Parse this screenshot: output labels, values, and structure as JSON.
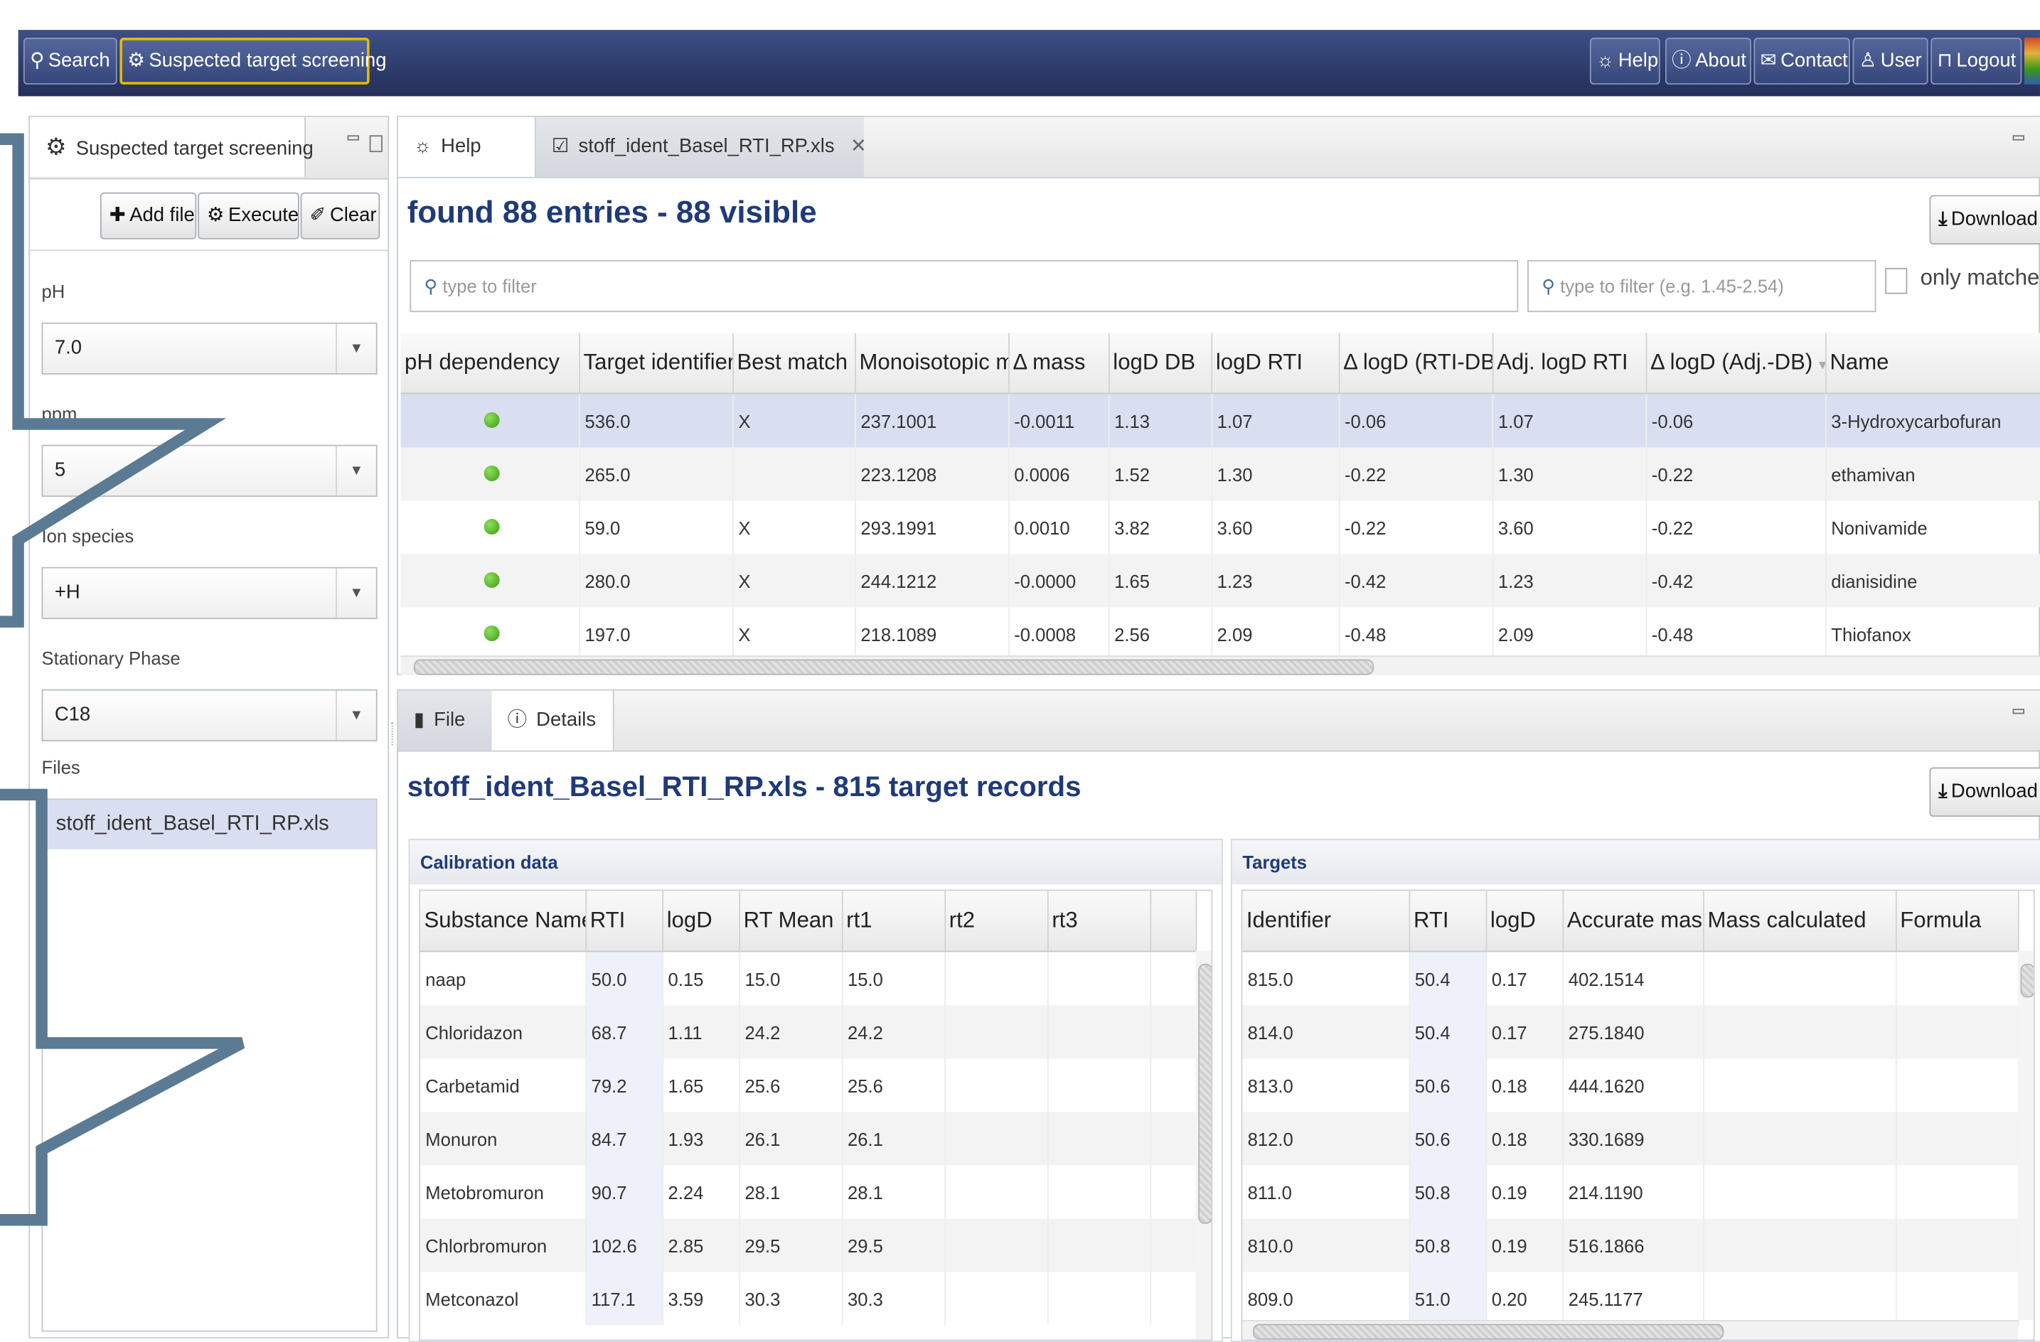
{
  "topbar": {
    "left_buttons": [
      {
        "label": "Search",
        "icon": "search-icon"
      },
      {
        "label": "Suspected target screening",
        "icon": "gear-icon"
      }
    ],
    "right_buttons": [
      {
        "label": "Help",
        "icon": "lightbulb-icon"
      },
      {
        "label": "About",
        "icon": "info-icon"
      },
      {
        "label": "Contact",
        "icon": "mail-icon"
      },
      {
        "label": "User",
        "icon": "user-icon"
      },
      {
        "label": "Logout",
        "icon": "unlock-icon"
      }
    ]
  },
  "left_panel": {
    "tab_label": "Suspected target screening",
    "buttons": {
      "add_file": "Add file",
      "execute": "Execute",
      "clear": "Clear"
    },
    "ph": {
      "label": "pH",
      "value": "7.0"
    },
    "ppm": {
      "label": "ppm",
      "value": "5"
    },
    "ion_species": {
      "label": "Ion species",
      "value": "+H"
    },
    "stationary_phase": {
      "label": "Stationary Phase",
      "value": "C18"
    },
    "files": {
      "label": "Files",
      "items": [
        "stoff_ident_Basel_RTI_RP.xls"
      ]
    }
  },
  "results_panel": {
    "tabs": [
      "Help",
      "stoff_ident_Basel_RTI_RP.xls"
    ],
    "heading": "found 88 entries - 88 visible",
    "download_label": "Download",
    "filter_placeholder": "type to filter",
    "filter2_placeholder": "type to filter (e.g. 1.45-2.54)",
    "only_matches_label": "only matches",
    "columns": [
      "pH dependency",
      "Target identifier",
      "Best match",
      "Monoisotopic ma",
      "Δ mass",
      "logD DB",
      "logD RTI",
      "Δ logD (RTI-DB)",
      "Adj. logD RTI",
      "Δ logD (Adj.-DB)",
      "Name"
    ],
    "rows": [
      [
        "",
        "536.0",
        "X",
        "237.1001",
        "-0.0011",
        "1.13",
        "1.07",
        "-0.06",
        "1.07",
        "-0.06",
        "3-Hydroxycarbofuran"
      ],
      [
        "",
        "265.0",
        "",
        "223.1208",
        "0.0006",
        "1.52",
        "1.30",
        "-0.22",
        "1.30",
        "-0.22",
        "ethamivan"
      ],
      [
        "",
        "59.0",
        "X",
        "293.1991",
        "0.0010",
        "3.82",
        "3.60",
        "-0.22",
        "3.60",
        "-0.22",
        "Nonivamide"
      ],
      [
        "",
        "280.0",
        "X",
        "244.1212",
        "-0.0000",
        "1.65",
        "1.23",
        "-0.42",
        "1.23",
        "-0.42",
        "dianisidine"
      ],
      [
        "",
        "197.0",
        "X",
        "218.1089",
        "-0.0008",
        "2.56",
        "2.09",
        "-0.48",
        "2.09",
        "-0.48",
        "Thiofanox"
      ]
    ]
  },
  "detail_panel": {
    "tabs": [
      "File",
      "Details"
    ],
    "heading": "stoff_ident_Basel_RTI_RP.xls - 815 target records",
    "download_label": "Download",
    "calibration": {
      "title": "Calibration data",
      "columns": [
        "Substance Name",
        "RTI",
        "logD",
        "RT Mean",
        "rt1",
        "rt2",
        "rt3"
      ],
      "rows": [
        [
          "naap",
          "50.0",
          "0.15",
          "15.0",
          "15.0",
          "",
          ""
        ],
        [
          "Chloridazon",
          "68.7",
          "1.11",
          "24.2",
          "24.2",
          "",
          ""
        ],
        [
          "Carbetamid",
          "79.2",
          "1.65",
          "25.6",
          "25.6",
          "",
          ""
        ],
        [
          "Monuron",
          "84.7",
          "1.93",
          "26.1",
          "26.1",
          "",
          ""
        ],
        [
          "Metobromuron",
          "90.7",
          "2.24",
          "28.1",
          "28.1",
          "",
          ""
        ],
        [
          "Chlorbromuron",
          "102.6",
          "2.85",
          "29.5",
          "29.5",
          "",
          ""
        ],
        [
          "Metconazol",
          "117.1",
          "3.59",
          "30.3",
          "30.3",
          "",
          ""
        ]
      ]
    },
    "targets": {
      "title": "Targets",
      "columns": [
        "Identifier",
        "RTI",
        "logD",
        "Accurate mass",
        "Mass calculated",
        "Formula"
      ],
      "rows": [
        [
          "815.0",
          "50.4",
          "0.17",
          "402.1514",
          "",
          ""
        ],
        [
          "814.0",
          "50.4",
          "0.17",
          "275.1840",
          "",
          ""
        ],
        [
          "813.0",
          "50.6",
          "0.18",
          "444.1620",
          "",
          ""
        ],
        [
          "812.0",
          "50.6",
          "0.18",
          "330.1689",
          "",
          ""
        ],
        [
          "811.0",
          "50.8",
          "0.19",
          "214.1190",
          "",
          ""
        ],
        [
          "810.0",
          "50.8",
          "0.19",
          "516.1866",
          "",
          ""
        ],
        [
          "809.0",
          "51.0",
          "0.20",
          "245.1177",
          "",
          ""
        ]
      ]
    }
  },
  "colors": {
    "topbar": "#2f3d6e",
    "heading": "#1f3a78",
    "selected_row": "#d9dff0",
    "annotation": "#5b7a93",
    "active_outline": "#e6b800"
  }
}
